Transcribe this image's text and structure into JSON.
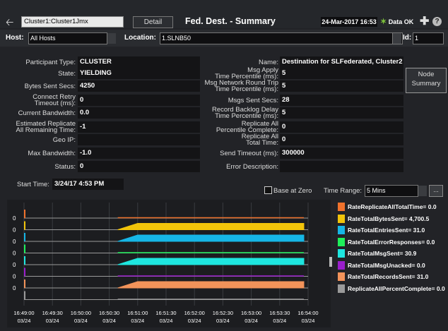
{
  "header": {
    "cluster_value": "Cluster1:Cluster1Jmx",
    "detail_label": "Detail",
    "title": "Fed. Dest. - Summary",
    "timestamp": "24-Mar-2017 16:53",
    "data_status": "Data OK"
  },
  "filters": {
    "host_label": "Host:",
    "host_value": "All Hosts",
    "location_label": "Location:",
    "location_value": "1.SLNB50",
    "id_label": "Id:",
    "id_value": "1"
  },
  "left_fields": [
    {
      "label": "Participant Type:",
      "value": "CLUSTER"
    },
    {
      "label": "State:",
      "value": "YIELDING"
    },
    {
      "label": "Bytes Sent Secs:",
      "value": "4250"
    },
    {
      "label": "Connect Retry\nTimeout (ms):",
      "value": "0"
    },
    {
      "label": "Current Bandwidth:",
      "value": "0.0"
    },
    {
      "label": "Estimated Replicate\nAll Remaining Time:",
      "value": "-1"
    },
    {
      "label": "Geo IP:",
      "value": ""
    },
    {
      "label": "Max Bandwidth:",
      "value": "-1.0"
    },
    {
      "label": "Status:",
      "value": "0"
    }
  ],
  "right_fields": [
    {
      "label": "Name:",
      "value": "Destination for SLFederated, Cluster2"
    },
    {
      "label": "Msg Apply\nTime Percentile (ms):",
      "value": "5"
    },
    {
      "label": "Msg Network Round Trip\nTime Percentile (ms):",
      "value": "5"
    },
    {
      "label": "Msgs Sent Secs:",
      "value": "28"
    },
    {
      "label": "Record Backlog Delay\nTime Percentile (ms):",
      "value": "5"
    },
    {
      "label": "Replicate All\nPercentile Complete:",
      "value": "0"
    },
    {
      "label": "Replicate All\nTotal Time:",
      "value": "0"
    },
    {
      "label": "Send Timeout (ms):",
      "value": "300000"
    },
    {
      "label": "Error Description:",
      "value": ""
    }
  ],
  "node_summary_label": "Node\nSummary",
  "start_time_label": "Start Time:",
  "start_time_value": "3/24/17 4:53 PM",
  "base_at_zero_label": "Base at Zero",
  "time_range_label": "Time Range:",
  "time_range_value": "5 Mins",
  "time_range_more": "...",
  "colors": {
    "rows": [
      "#f0722c",
      "#f2c40a",
      "#16b6e6",
      "#1ef05a",
      "#1ee6e0",
      "#9a1ecc",
      "#f2935a",
      "#9a9a9a"
    ]
  },
  "chart_data": {
    "type": "line",
    "x": [
      "16:49:00\n03/24",
      "16:49:30\n03/24",
      "16:50:00\n03/24",
      "16:50:30\n03/24",
      "16:51:00\n03/24",
      "16:51:30\n03/24",
      "16:52:00\n03/24",
      "16:52:30\n03/24",
      "16:53:00\n03/24",
      "16:53:30\n03/24",
      "16:54:00\n03/24"
    ],
    "series": [
      {
        "name": "RateReplicateAllTotalTime",
        "value_label": "0.0",
        "ytick": "0",
        "fill": false
      },
      {
        "name": "RateTotalBytesSent",
        "value_label": "4,700.5",
        "ytick": "0",
        "fill": true
      },
      {
        "name": "RateTotalEntriesSent",
        "value_label": "31.0",
        "ytick": "0",
        "fill": true
      },
      {
        "name": "RateTotalErrorResponses",
        "value_label": "0.0",
        "ytick": "0",
        "fill": false
      },
      {
        "name": "RateTotalMsgSent",
        "value_label": "30.9",
        "ytick": "0",
        "fill": true
      },
      {
        "name": "RateTotalMsgUnacked",
        "value_label": "0.0",
        "ytick": "0",
        "fill": false
      },
      {
        "name": "RateTotalRecordsSent",
        "value_label": "31.0",
        "ytick": "0",
        "fill": true
      },
      {
        "name": "ReplicateAllPercentComplete",
        "value_label": "0.0",
        "ytick": "",
        "fill": false
      }
    ]
  }
}
